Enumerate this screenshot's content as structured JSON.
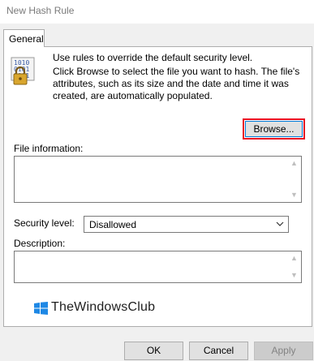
{
  "window": {
    "title": "New Hash Rule"
  },
  "tabs": [
    {
      "label": "General"
    }
  ],
  "intro": {
    "line1": "Use rules to override the default security level.",
    "line2": "Click Browse to select the file you want to hash. The file's attributes, such as its size and the date and time it was created, are automatically populated."
  },
  "browse_button": {
    "label": "Browse..."
  },
  "file_information": {
    "label": "File information:",
    "value": ""
  },
  "security_level": {
    "label": "Security level:",
    "selected": "Disallowed"
  },
  "description": {
    "label": "Description:",
    "value": ""
  },
  "watermark": {
    "text": "TheWindowsClub"
  },
  "footer": {
    "ok_label": "OK",
    "cancel_label": "Cancel",
    "apply_label": "Apply"
  },
  "colors": {
    "highlight_border": "#e81123",
    "focus_border": "#0078d7",
    "logo_blue": "#1e88e5"
  },
  "icons": {
    "rule": "binary-lock-icon",
    "dropdown": "chevron-down-icon",
    "scroll_up": "scroll-up-arrow-icon",
    "scroll_down": "scroll-down-arrow-icon"
  }
}
